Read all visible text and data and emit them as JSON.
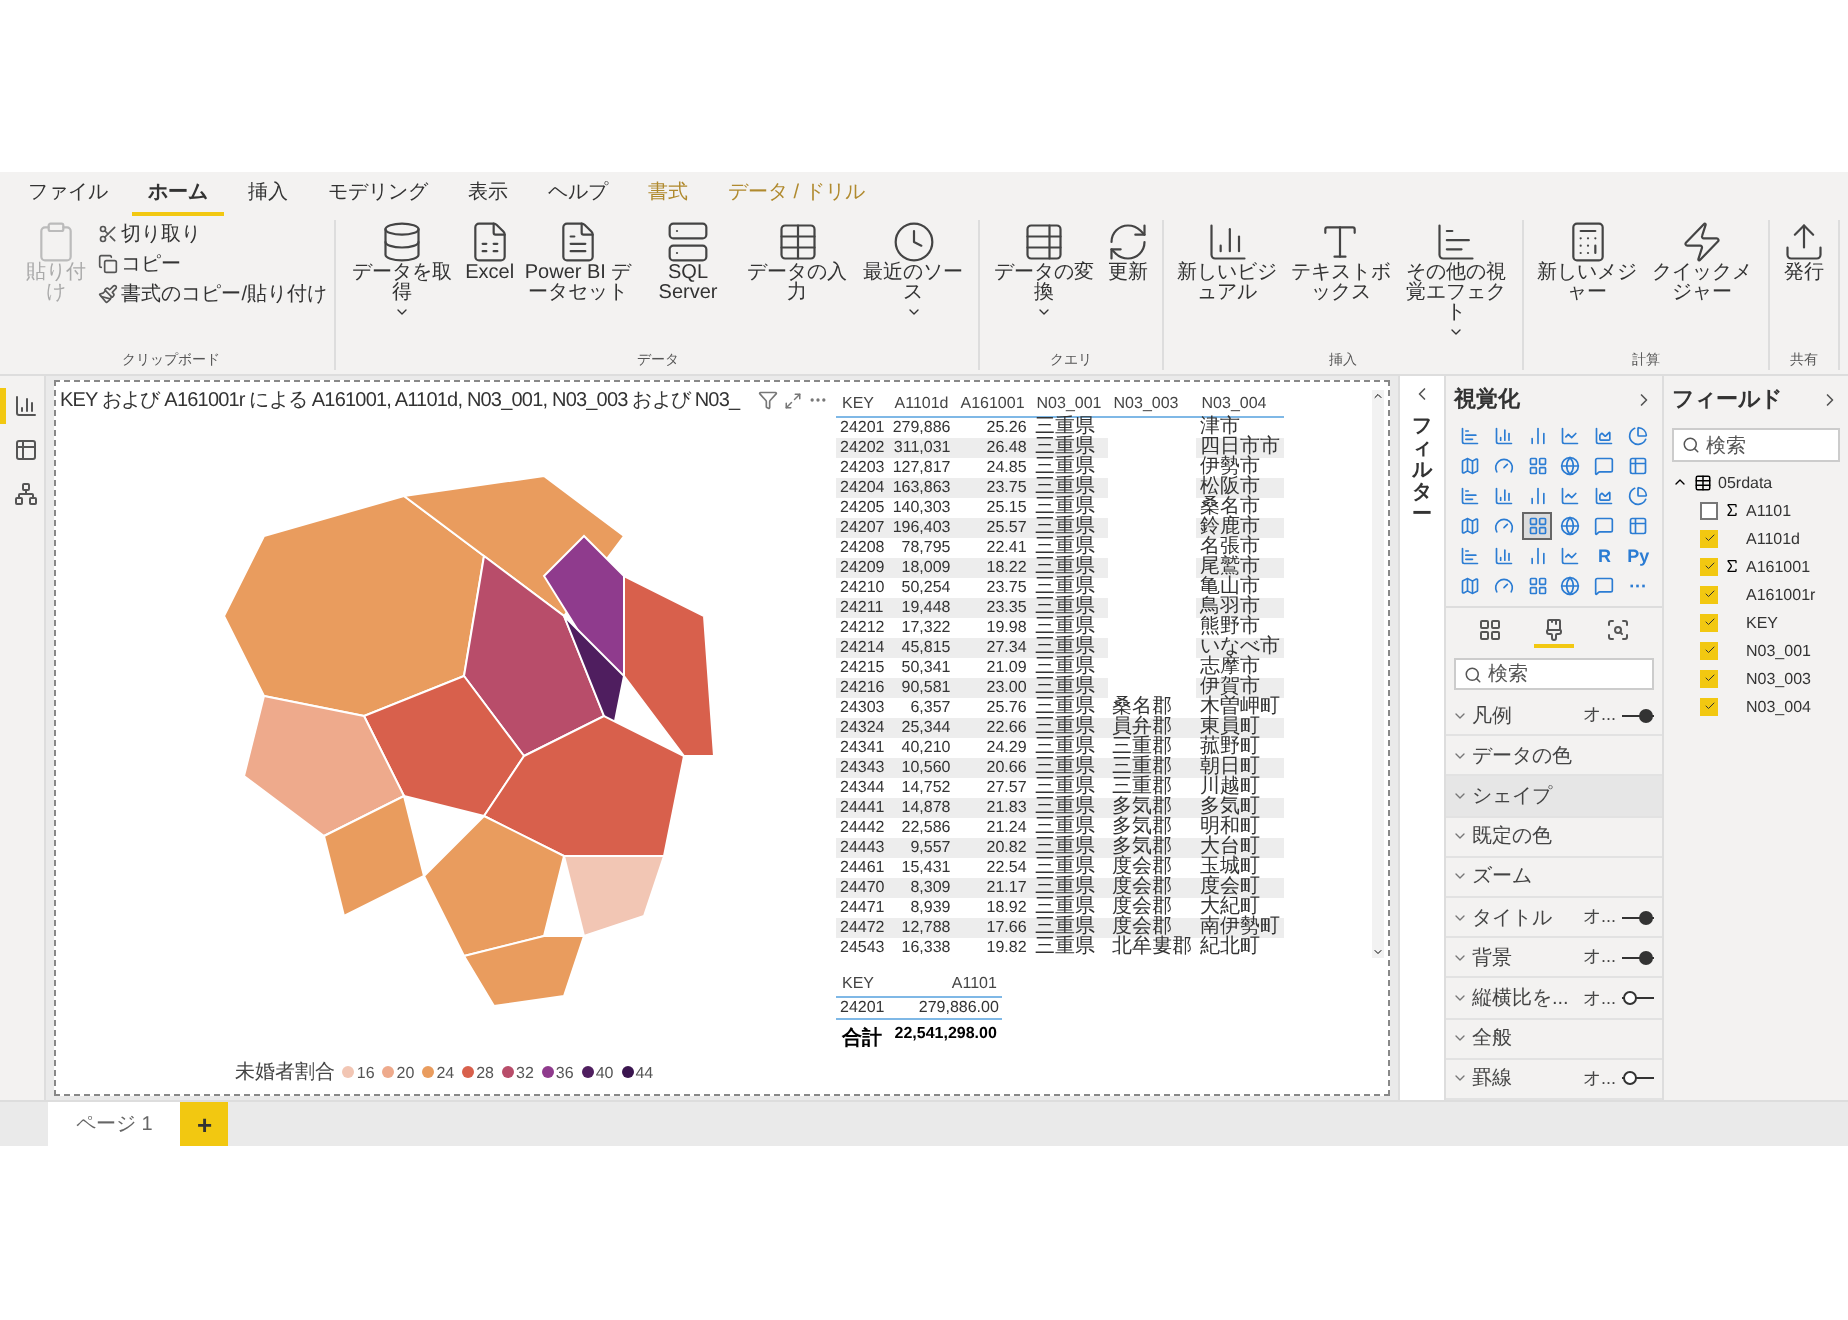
{
  "menu_tabs": [
    {
      "label": "ファイル",
      "selected": false,
      "kind": "normal"
    },
    {
      "label": "ホーム",
      "selected": true,
      "kind": "normal"
    },
    {
      "label": "挿入",
      "selected": false,
      "kind": "normal"
    },
    {
      "label": "モデリング",
      "selected": false,
      "kind": "normal"
    },
    {
      "label": "表示",
      "selected": false,
      "kind": "normal"
    },
    {
      "label": "ヘルプ",
      "selected": false,
      "kind": "normal"
    },
    {
      "label": "書式",
      "selected": false,
      "kind": "contextual"
    },
    {
      "label": "データ / ドリル",
      "selected": false,
      "kind": "contextual"
    }
  ],
  "ribbon_groups": [
    {
      "label": "クリップボード",
      "buttons": [
        {
          "label": "貼り付け",
          "kind": "large",
          "disabled": true
        },
        {
          "label": "切り取り",
          "kind": "small"
        },
        {
          "label": "コピー",
          "kind": "small"
        },
        {
          "label": "書式のコピー/貼り付け",
          "kind": "small"
        }
      ]
    },
    {
      "label": "データ",
      "buttons": [
        {
          "label": "データを取得",
          "kind": "large",
          "dropdown": true
        },
        {
          "label": "Excel",
          "kind": "large"
        },
        {
          "label": "Power BI データセット",
          "kind": "large"
        },
        {
          "label": "SQL Server",
          "kind": "large"
        },
        {
          "label": "データの入力",
          "kind": "large"
        },
        {
          "label": "最近のソース",
          "kind": "large",
          "dropdown": true
        }
      ]
    },
    {
      "label": "クエリ",
      "buttons": [
        {
          "label": "データの変換",
          "kind": "large",
          "dropdown": true
        },
        {
          "label": "更新",
          "kind": "large"
        }
      ]
    },
    {
      "label": "挿入",
      "buttons": [
        {
          "label": "新しいビジュアル",
          "kind": "large"
        },
        {
          "label": "テキストボックス",
          "kind": "large"
        },
        {
          "label": "その他の視覚エフェクト",
          "kind": "large",
          "dropdown": true
        }
      ]
    },
    {
      "label": "計算",
      "buttons": [
        {
          "label": "新しいメジャー",
          "kind": "large"
        },
        {
          "label": "クイックメジャー",
          "kind": "large"
        }
      ]
    },
    {
      "label": "共有",
      "buttons": [
        {
          "label": "発行",
          "kind": "large"
        }
      ]
    }
  ],
  "nav_items": [
    {
      "selected": true
    },
    {
      "selected": false
    },
    {
      "selected": false
    }
  ],
  "map_visual": {
    "title": "KEY および A161001r による A161001, A1101d, N03_001, N03_003 および N03_",
    "legend": {
      "title": "未婚者割合",
      "items": [
        {
          "label": "16",
          "color": "#f2c6b4"
        },
        {
          "label": "20",
          "color": "#eeaa8c"
        },
        {
          "label": "24",
          "color": "#e99c5e"
        },
        {
          "label": "28",
          "color": "#d8604c"
        },
        {
          "label": "32",
          "color": "#b84d6a"
        },
        {
          "label": "36",
          "color": "#8f3b8d"
        },
        {
          "label": "40",
          "color": "#4f1e5f"
        },
        {
          "label": "44",
          "color": "#3a154f"
        }
      ]
    }
  },
  "table": {
    "columns": [
      "KEY",
      "A1101d",
      "A161001",
      "N03_001",
      "N03_003",
      "N03_004"
    ],
    "rows": [
      [
        "24201",
        "279,886",
        "25.26",
        "三重県",
        "",
        "津市"
      ],
      [
        "24202",
        "311,031",
        "26.48",
        "三重県",
        "",
        "四日市市"
      ],
      [
        "24203",
        "127,817",
        "24.85",
        "三重県",
        "",
        "伊勢市"
      ],
      [
        "24204",
        "163,863",
        "23.75",
        "三重県",
        "",
        "松阪市"
      ],
      [
        "24205",
        "140,303",
        "25.15",
        "三重県",
        "",
        "桑名市"
      ],
      [
        "24207",
        "196,403",
        "25.57",
        "三重県",
        "",
        "鈴鹿市"
      ],
      [
        "24208",
        "78,795",
        "22.41",
        "三重県",
        "",
        "名張市"
      ],
      [
        "24209",
        "18,009",
        "18.22",
        "三重県",
        "",
        "尾鷲市"
      ],
      [
        "24210",
        "50,254",
        "23.75",
        "三重県",
        "",
        "亀山市"
      ],
      [
        "24211",
        "19,448",
        "23.35",
        "三重県",
        "",
        "鳥羽市"
      ],
      [
        "24212",
        "17,322",
        "19.98",
        "三重県",
        "",
        "熊野市"
      ],
      [
        "24214",
        "45,815",
        "27.34",
        "三重県",
        "",
        "いなべ市"
      ],
      [
        "24215",
        "50,341",
        "21.09",
        "三重県",
        "",
        "志摩市"
      ],
      [
        "24216",
        "90,581",
        "23.00",
        "三重県",
        "",
        "伊賀市"
      ],
      [
        "24303",
        "6,357",
        "25.76",
        "三重県",
        "桑名郡",
        "木曽岬町"
      ],
      [
        "24324",
        "25,344",
        "22.66",
        "三重県",
        "員弁郡",
        "東員町"
      ],
      [
        "24341",
        "40,210",
        "24.29",
        "三重県",
        "三重郡",
        "菰野町"
      ],
      [
        "24343",
        "10,560",
        "20.66",
        "三重県",
        "三重郡",
        "朝日町"
      ],
      [
        "24344",
        "14,752",
        "27.57",
        "三重県",
        "三重郡",
        "川越町"
      ],
      [
        "24441",
        "14,878",
        "21.83",
        "三重県",
        "多気郡",
        "多気町"
      ],
      [
        "24442",
        "22,586",
        "21.24",
        "三重県",
        "多気郡",
        "明和町"
      ],
      [
        "24443",
        "9,557",
        "20.82",
        "三重県",
        "多気郡",
        "大台町"
      ],
      [
        "24461",
        "15,431",
        "22.54",
        "三重県",
        "度会郡",
        "玉城町"
      ],
      [
        "24470",
        "8,309",
        "21.17",
        "三重県",
        "度会郡",
        "度会町"
      ],
      [
        "24471",
        "8,939",
        "18.92",
        "三重県",
        "度会郡",
        "大紀町"
      ],
      [
        "24472",
        "12,788",
        "17.66",
        "三重県",
        "度会郡",
        "南伊勢町"
      ],
      [
        "24543",
        "16,338",
        "19.82",
        "三重県",
        "北牟婁郡",
        "紀北町"
      ]
    ]
  },
  "summary_table": {
    "columns": [
      "KEY",
      "A1101"
    ],
    "rows": [
      [
        "24201",
        "279,886.00"
      ]
    ],
    "total": [
      "合計",
      "22,541,298.00"
    ]
  },
  "filter_pane": {
    "label": "フィルター"
  },
  "visualizations": {
    "title": "視覚化",
    "types": [
      {
        "kind": "icon",
        "selected": false
      },
      {
        "kind": "icon",
        "selected": false
      },
      {
        "kind": "icon",
        "selected": false
      },
      {
        "kind": "icon",
        "selected": false
      },
      {
        "kind": "icon",
        "selected": false
      },
      {
        "kind": "icon",
        "selected": false
      },
      {
        "kind": "icon",
        "selected": false
      },
      {
        "kind": "icon",
        "selected": false
      },
      {
        "kind": "icon",
        "selected": false
      },
      {
        "kind": "icon",
        "selected": false
      },
      {
        "kind": "icon",
        "selected": false
      },
      {
        "kind": "icon",
        "selected": false
      },
      {
        "kind": "icon",
        "selected": false
      },
      {
        "kind": "icon",
        "selected": false
      },
      {
        "kind": "icon",
        "selected": false
      },
      {
        "kind": "icon",
        "selected": false
      },
      {
        "kind": "icon",
        "selected": false
      },
      {
        "kind": "icon",
        "selected": false
      },
      {
        "kind": "icon",
        "selected": false
      },
      {
        "kind": "icon",
        "selected": false
      },
      {
        "kind": "icon",
        "selected": true
      },
      {
        "kind": "icon",
        "selected": false
      },
      {
        "kind": "icon",
        "selected": false
      },
      {
        "kind": "icon",
        "selected": false
      },
      {
        "kind": "icon",
        "selected": false
      },
      {
        "kind": "icon",
        "selected": false
      },
      {
        "kind": "icon",
        "selected": false
      },
      {
        "kind": "icon",
        "selected": false
      },
      {
        "kind": "text",
        "label": "R"
      },
      {
        "kind": "text",
        "label": "Py"
      },
      {
        "kind": "icon",
        "selected": false
      },
      {
        "kind": "icon",
        "selected": false
      },
      {
        "kind": "icon",
        "selected": false
      },
      {
        "kind": "icon",
        "selected": false
      },
      {
        "kind": "icon",
        "selected": false
      },
      {
        "kind": "text",
        "label": "···"
      }
    ],
    "pane_tabs": [
      {
        "selected": false
      },
      {
        "selected": true
      },
      {
        "selected": false
      }
    ],
    "search_placeholder": "検索",
    "sections": [
      {
        "label": "凡例",
        "on": true,
        "toggle_text": "オ...",
        "selected": false
      },
      {
        "label": "データの色",
        "selected": false
      },
      {
        "label": "シェイプ",
        "selected": true
      },
      {
        "label": "既定の色",
        "selected": false
      },
      {
        "label": "ズーム",
        "selected": false
      },
      {
        "label": "タイトル",
        "on": true,
        "toggle_text": "オ...",
        "selected": false
      },
      {
        "label": "背景",
        "on": true,
        "toggle_text": "オ...",
        "selected": false
      },
      {
        "label": "縦横比を...",
        "on": false,
        "toggle_text": "オ...",
        "selected": false
      },
      {
        "label": "全般",
        "selected": false
      },
      {
        "label": "罫線",
        "on": false,
        "toggle_text": "オ...",
        "selected": false
      }
    ]
  },
  "fields": {
    "title": "フィールド",
    "search_placeholder": "検索",
    "tables": [
      {
        "name": "05rdata",
        "expanded": true,
        "fields": [
          {
            "name": "A1101",
            "checked": false,
            "sum": true
          },
          {
            "name": "A1101d",
            "checked": true,
            "sum": false
          },
          {
            "name": "A161001",
            "checked": true,
            "sum": true
          },
          {
            "name": "A161001r",
            "checked": true,
            "sum": false
          },
          {
            "name": "KEY",
            "checked": true,
            "sum": false
          },
          {
            "name": "N03_001",
            "checked": true,
            "sum": false
          },
          {
            "name": "N03_003",
            "checked": true,
            "sum": false
          },
          {
            "name": "N03_004",
            "checked": true,
            "sum": false
          }
        ]
      }
    ]
  },
  "page_tabs": [
    {
      "label": "ページ 1",
      "selected": true
    }
  ],
  "add_page": "+"
}
